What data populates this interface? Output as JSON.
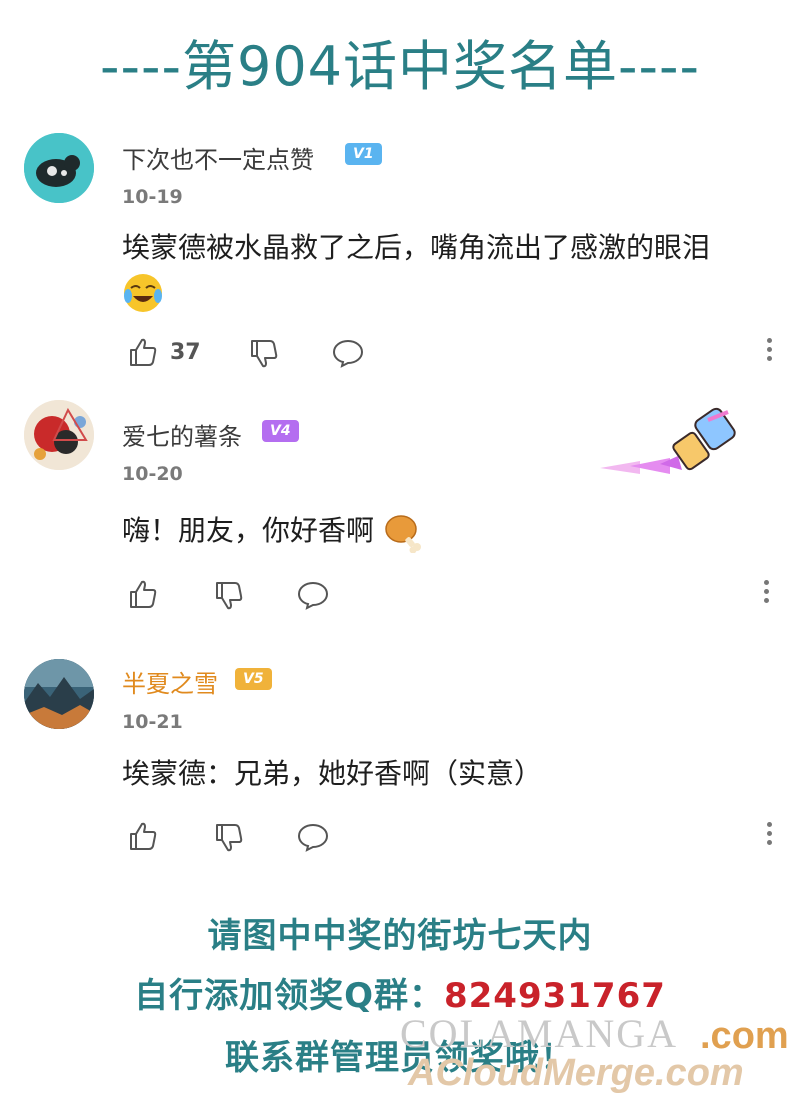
{
  "header": {
    "title": "----第904话中奖名单----"
  },
  "comments": [
    {
      "username": "下次也不一定点赞",
      "level": "V1",
      "level_color": "#5ab4f0",
      "date": "10-19",
      "text": "埃蒙德被水晶救了之后，嘴角流出了感激的眼泪",
      "emoji": "crying-laughing-emoji",
      "likes": "37",
      "avatar": "cat-on-teal-avatar"
    },
    {
      "username": "爱七的薯条",
      "level": "V4",
      "level_color": "#b46ef0",
      "date": "10-20",
      "text": "嗨！朋友，你好香啊",
      "emoji": "chicken-leg-emoji",
      "likes": "",
      "avatar": "anime-collage-avatar",
      "decoration": "paintbrush-decoration"
    },
    {
      "username": "半夏之雪",
      "level": "V5",
      "level_color": "#f0b23a",
      "date": "10-21",
      "text": "埃蒙德：兄弟，她好香啊（实意）",
      "likes": "",
      "avatar": "mountain-landscape-avatar"
    }
  ],
  "footer": {
    "line1": "请图中中奖的街坊七天内",
    "line2_prefix": "自行添加领奖Q群：",
    "line2_qq": "824931767",
    "line3": "联系群管理员领奖哦！"
  },
  "watermark": {
    "site": "COLAMANGA",
    "domain": ".com",
    "merge": "ACloudMerge.com"
  }
}
